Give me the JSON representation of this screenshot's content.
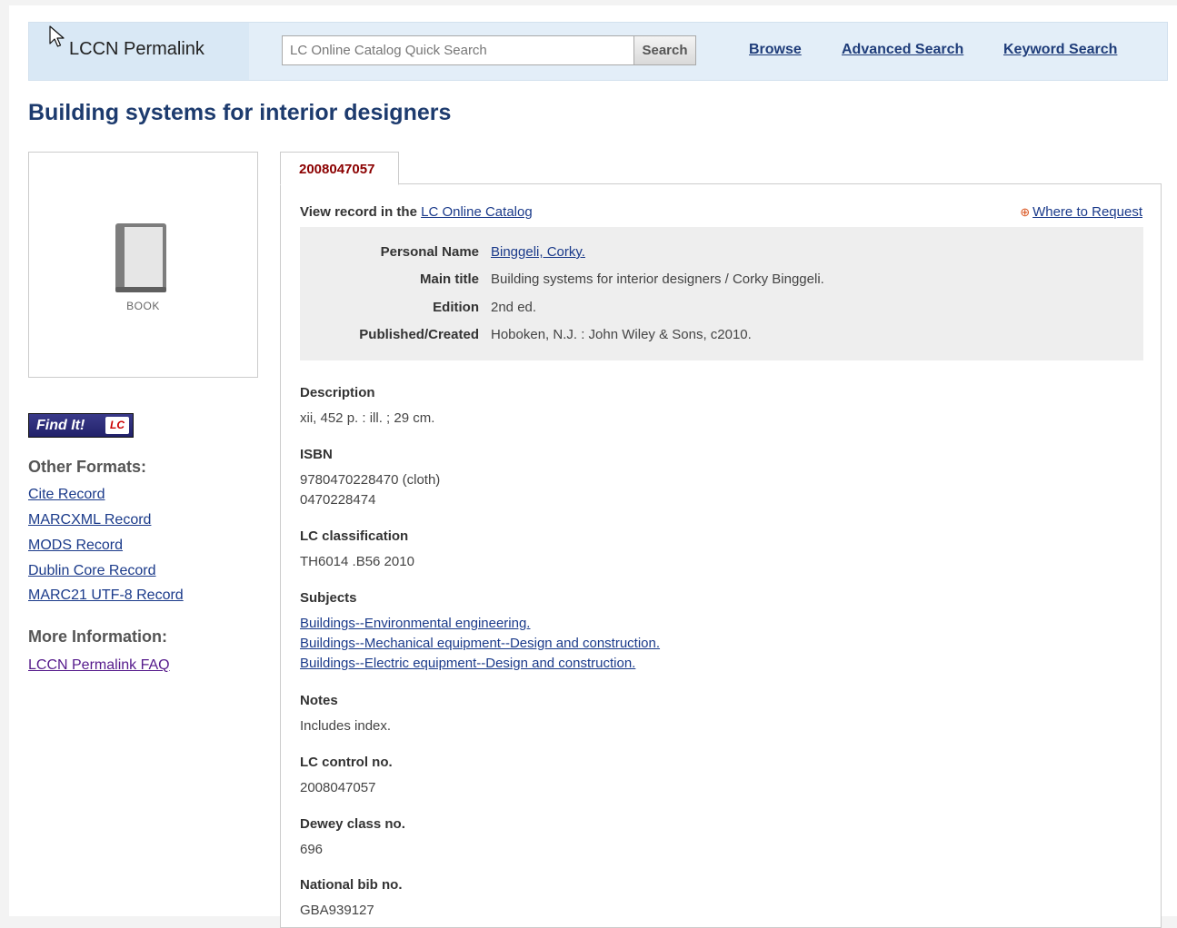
{
  "header": {
    "brand": "LCCN Permalink",
    "search_placeholder": "LC Online Catalog Quick Search",
    "search_button": "Search",
    "links": {
      "browse": "Browse",
      "advanced": "Advanced Search",
      "keyword": "Keyword Search"
    }
  },
  "title": "Building systems for interior designers",
  "thumbnail": {
    "label": "BOOK",
    "icon": "book-icon"
  },
  "sidebar": {
    "findit_text": "Find It!",
    "findit_badge": "LC",
    "other_formats_heading": "Other Formats:",
    "formats": [
      "Cite Record",
      "MARCXML Record",
      "MODS Record",
      "Dublin Core Record",
      "MARC21 UTF-8 Record"
    ],
    "more_info_heading": "More Information:",
    "faq": "LCCN Permalink FAQ"
  },
  "record": {
    "tab": "2008047057",
    "view_prefix": "View record in the",
    "view_link": "LC Online Catalog",
    "where_to_request": "Where to Request",
    "summary": [
      {
        "label": "Personal Name",
        "value": "Binggeli, Corky.",
        "link": true
      },
      {
        "label": "Main title",
        "value": "Building systems for interior designers / Corky Binggeli.",
        "link": false
      },
      {
        "label": "Edition",
        "value": "2nd ed.",
        "link": false
      },
      {
        "label": "Published/Created",
        "value": "Hoboken, N.J. : John Wiley & Sons, c2010.",
        "link": false
      }
    ],
    "fields": [
      {
        "label": "Description",
        "values": [
          "xii, 452 p. : ill. ; 29 cm."
        ],
        "link": false
      },
      {
        "label": "ISBN",
        "values": [
          "9780470228470 (cloth)",
          "0470228474"
        ],
        "link": false
      },
      {
        "label": "LC classification",
        "values": [
          "TH6014 .B56 2010"
        ],
        "link": false
      },
      {
        "label": "Subjects",
        "values": [
          "Buildings--Environmental engineering.",
          "Buildings--Mechanical equipment--Design and construction.",
          "Buildings--Electric equipment--Design and construction."
        ],
        "link": true
      },
      {
        "label": "Notes",
        "values": [
          "Includes index."
        ],
        "link": false
      },
      {
        "label": "LC control no.",
        "values": [
          "2008047057"
        ],
        "link": false
      },
      {
        "label": "Dewey class no.",
        "values": [
          "696"
        ],
        "link": false
      },
      {
        "label": "National bib no.",
        "values": [
          "GBA939127"
        ],
        "link": false
      }
    ]
  }
}
